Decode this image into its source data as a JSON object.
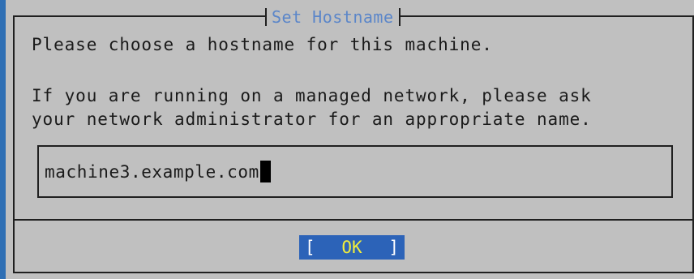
{
  "dialog": {
    "title": "Set Hostname",
    "line1": "Please choose a hostname for this machine.",
    "line2": "If you are running on a managed network, please ask",
    "line3": "your network administrator for an appropriate name.",
    "hostname_value": "machine3.example.com",
    "ok_bracket_left": "[",
    "ok_label": "OK",
    "ok_bracket_right": "]"
  },
  "colors": {
    "background": "#2f6fb4",
    "dialog_bg": "#c0c0c0",
    "title_text": "#5b86c9",
    "button_bg": "#2c63b8",
    "button_text": "#f2ef3a"
  }
}
